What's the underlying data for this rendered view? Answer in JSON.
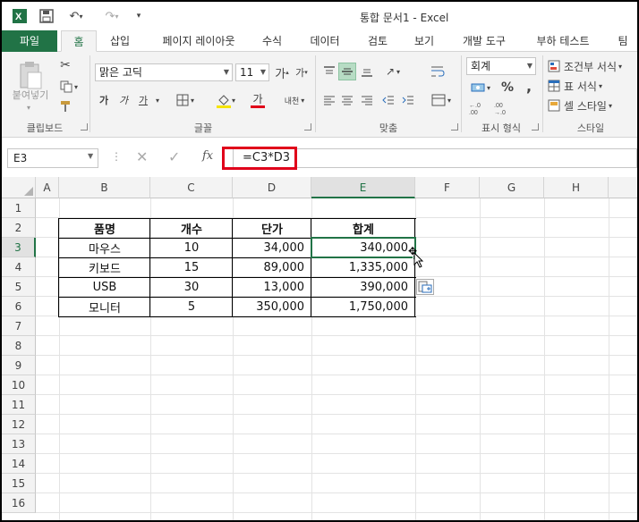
{
  "app": {
    "title": "통합 문서1 - Excel",
    "icon": "excel-icon"
  },
  "tabs": [
    "파일",
    "홈",
    "삽입",
    "페이지 레이아웃",
    "수식",
    "데이터",
    "검토",
    "보기",
    "개발 도구",
    "부하 테스트",
    "팀"
  ],
  "ribbon": {
    "clipboard": {
      "paste_label": "붙여넣기",
      "group_label": "클립보드"
    },
    "font": {
      "font_name": "맑은 고딕",
      "font_size": "11",
      "bold": "가",
      "italic": "가",
      "underline": "가",
      "font_color": "가",
      "phonetic": "내천",
      "group_label": "글꼴"
    },
    "alignment": {
      "group_label": "맞춤"
    },
    "number": {
      "format": "회계",
      "percent": "%",
      "comma": ",",
      "group_label": "표시 형식"
    },
    "styles": {
      "conditional": "조건부 서식",
      "table": "표 서식",
      "cell": "셀 스타일",
      "group_label": "스타일"
    }
  },
  "formula_bar": {
    "name_box": "E3",
    "fx": "fx",
    "formula": "=C3*D3"
  },
  "columns": [
    "A",
    "B",
    "C",
    "D",
    "E",
    "F",
    "G",
    "H"
  ],
  "rows": [
    "1",
    "2",
    "3",
    "4",
    "5",
    "6",
    "7",
    "8",
    "9",
    "10",
    "11",
    "12",
    "13",
    "14",
    "15",
    "16"
  ],
  "table": {
    "headers": [
      "품명",
      "개수",
      "단가",
      "합계"
    ],
    "rows": [
      [
        "마우스",
        "10",
        "34,000",
        "340,000"
      ],
      [
        "키보드",
        "15",
        "89,000",
        "1,335,000"
      ],
      [
        "USB",
        "30",
        "13,000",
        "390,000"
      ],
      [
        "모니터",
        "5",
        "350,000",
        "1,750,000"
      ]
    ]
  },
  "selected_cell": "E3",
  "colors": {
    "accent": "#217346",
    "highlight_red": "#e0001a",
    "font_red": "#e0001a"
  }
}
